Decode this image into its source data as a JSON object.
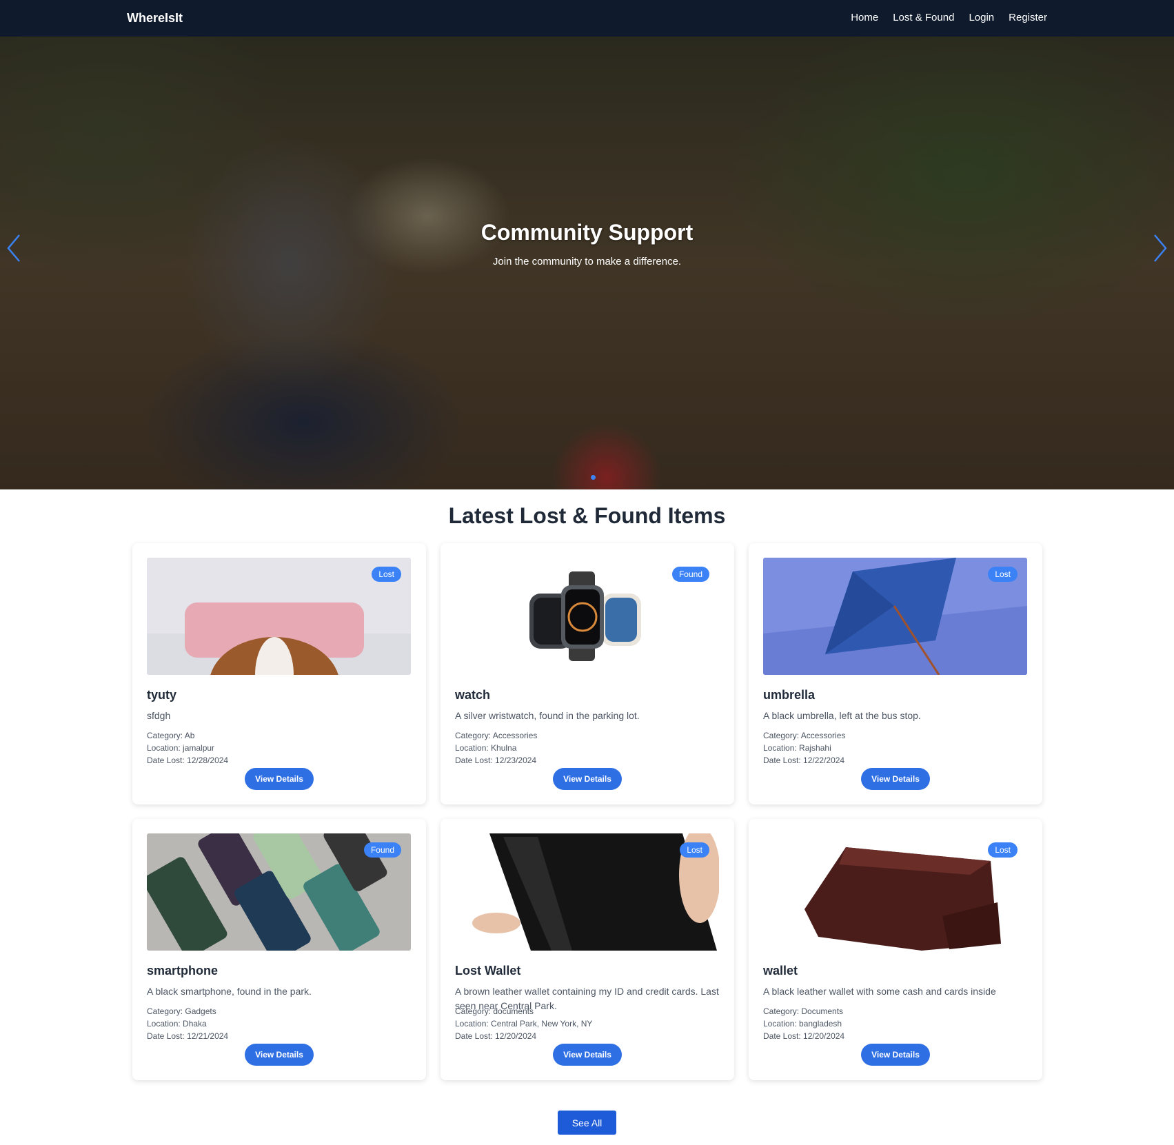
{
  "navbar": {
    "brand": "WhereIsIt",
    "links": [
      "Home",
      "Lost & Found",
      "Login",
      "Register"
    ]
  },
  "hero": {
    "title": "Community Support",
    "subtitle": "Join the community to make a difference.",
    "prev_icon": "chevron-left-icon",
    "next_icon": "chevron-right-icon",
    "accent": "#3b82f6"
  },
  "section": {
    "title": "Latest Lost & Found Items"
  },
  "items": [
    {
      "status": "Lost",
      "title": "tyuty",
      "description": "sfdgh",
      "category": "Category: Ab",
      "location": "Location: jamalpur",
      "date": "Date Lost: 12/28/2024",
      "button": "View Details"
    },
    {
      "status": "Found",
      "title": "watch",
      "description": "A silver wristwatch, found in the parking lot.",
      "category": "Category: Accessories",
      "location": "Location: Khulna",
      "date": "Date Lost: 12/23/2024",
      "button": "View Details"
    },
    {
      "status": "Lost",
      "title": "umbrella",
      "description": "A black umbrella, left at the bus stop.",
      "category": "Category: Accessories",
      "location": "Location: Rajshahi",
      "date": "Date Lost: 12/22/2024",
      "button": "View Details"
    },
    {
      "status": "Found",
      "title": "smartphone",
      "description": "A black smartphone, found in the park.",
      "category": "Category: Gadgets",
      "location": "Location: Dhaka",
      "date": "Date Lost: 12/21/2024",
      "button": "View Details"
    },
    {
      "status": "Lost",
      "title": "Lost Wallet",
      "description": "A brown leather wallet containing my ID and credit cards. Last seen near Central Park.",
      "category": "Category: documents",
      "location": "Location: Central Park, New York, NY",
      "date": "Date Lost: 12/20/2024",
      "button": "View Details"
    },
    {
      "status": "Lost",
      "title": "wallet",
      "description": "A black leather wallet with some cash and cards inside",
      "category": "Category: Documents",
      "location": "Location: bangladesh",
      "date": "Date Lost: 12/20/2024",
      "button": "View Details"
    }
  ],
  "see_all": "See All",
  "colors": {
    "navbar": "#0f1b2d",
    "primary": "#2f6fe4",
    "badge": "#3b82f6"
  }
}
